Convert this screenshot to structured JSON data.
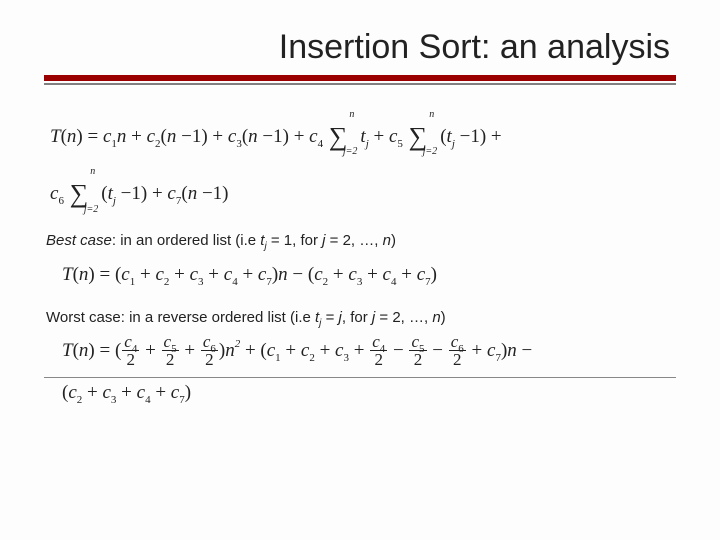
{
  "title": "Insertion Sort: an analysis",
  "eq1_a": "T(n) = c₁n + c₂(n−1) + c₃(n−1) + c₄ Σ_{j=2}^{n} t_j + c₅ Σ_{j=2}^{n} (t_j − 1) +",
  "eq1_b": "c₆ Σ_{j=2}^{n} (t_j − 1) + c₇(n−1)",
  "best_case": {
    "label": "Best case",
    "text": ": in an ordered list (i.e ",
    "tj": "t",
    "tjsub": "j",
    "rest": " = 1, for ",
    "j": "j",
    "rest2": " = 2, …, ",
    "n": "n",
    "close": ")"
  },
  "eq2": "T(n) = (c₁ + c₂ + c₃ + c₄ + c₇)n − (c₂ + c₃ + c₄ + c₇)",
  "worst_case": {
    "label": "Worst case:",
    "text": " in a reverse ordered list (i.e ",
    "tj": "t",
    "tjsub": "j",
    "eq": " = ",
    "j": "j",
    "rest": ", for ",
    "j2": "j",
    "rest2": " = 2, …, ",
    "n": "n",
    "close": ")"
  },
  "eq3_lead": "T(n) = (",
  "eq3_f1n": "c₄",
  "eq3_f1d": "2",
  "eq3_f2n": "c₅",
  "eq3_f2d": "2",
  "eq3_f3n": "c₆",
  "eq3_f3d": "2",
  "eq3_mid1": ")n² + (c₁ + c₂ + c₃ + ",
  "eq3_f4n": "c₄",
  "eq3_f4d": "2",
  "eq3_m2": " − ",
  "eq3_f5n": "c₅",
  "eq3_f5d": "2",
  "eq3_m3": " − ",
  "eq3_f6n": "c₆",
  "eq3_f6d": "2",
  "eq3_mid2": " + c₇)n −",
  "eq3_tail": "(c₂ + c₃ + c₄ + c₇)"
}
